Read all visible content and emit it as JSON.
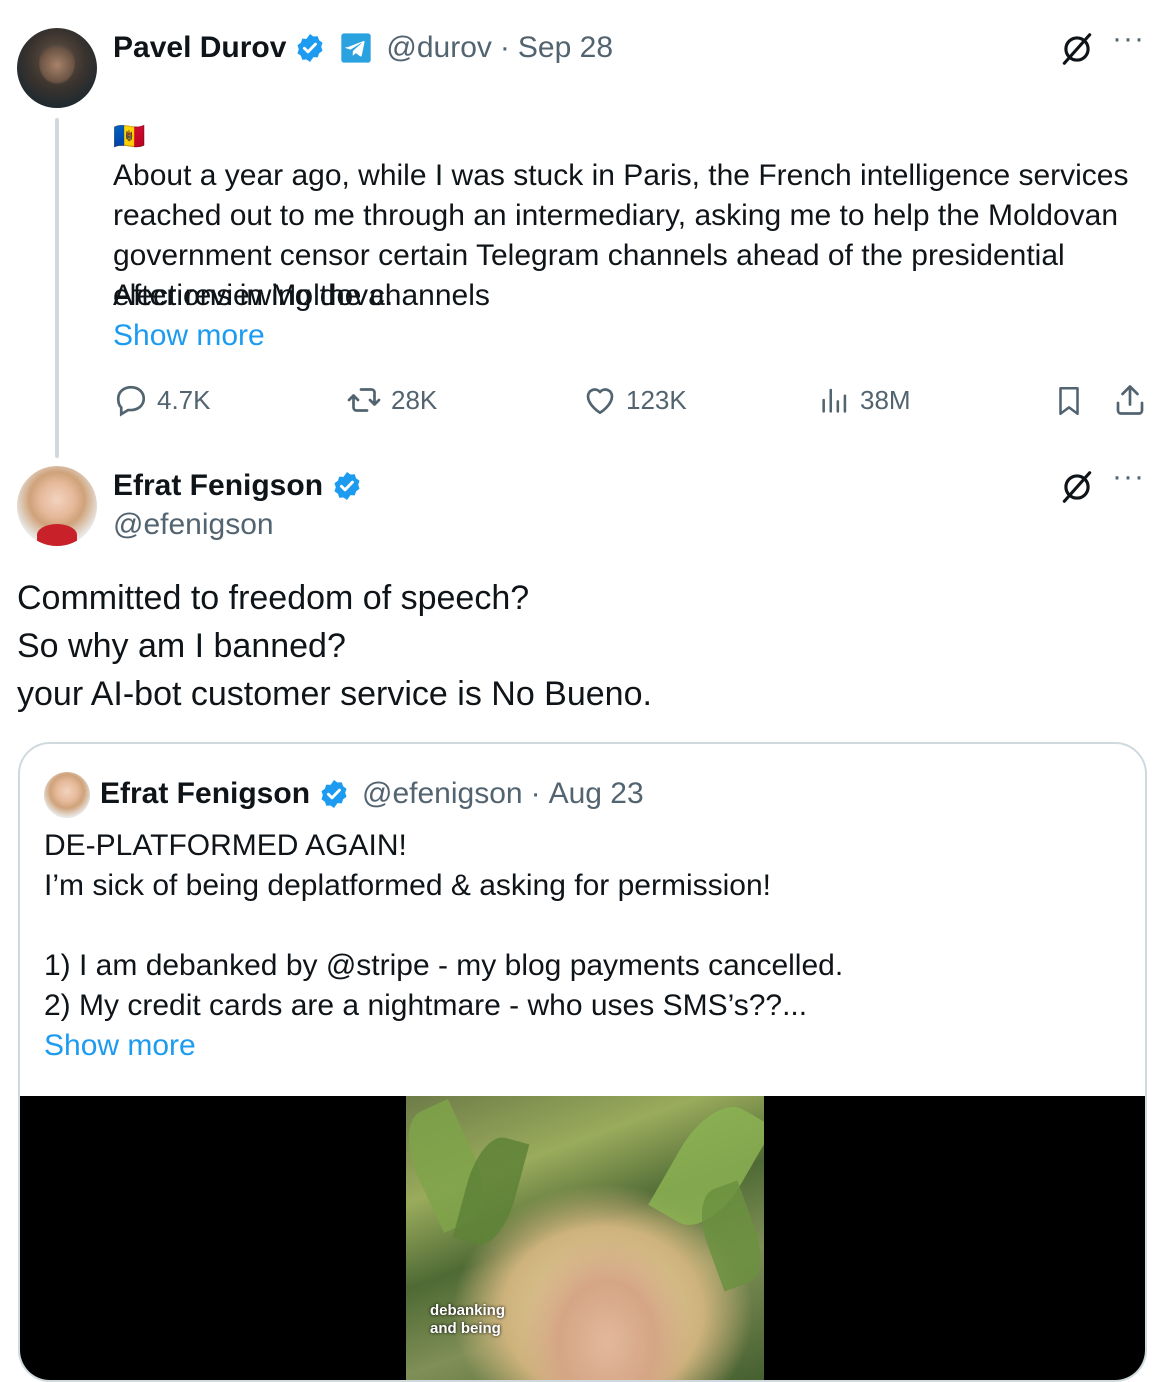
{
  "tweet1": {
    "name": "Pavel Durov",
    "handle": "@durov",
    "date": "Sep 28",
    "flag": "🇲🇩",
    "text": "About a year ago, while I was stuck in Paris, the French intelligence services reached out to me through an intermediary, asking me to help the Moldovan government censor certain Telegram channels ahead of the presidential elections in Moldova.",
    "text2": "After reviewing the channels",
    "show_more": "Show more",
    "stats": {
      "replies": "4.7K",
      "reposts": "28K",
      "likes": "123K",
      "views": "38M"
    }
  },
  "tweet2": {
    "name": "Efrat Fenigson",
    "handle": "@efenigson",
    "lines": [
      "Committed to freedom of speech?",
      "So why am I banned?",
      "your AI-bot customer service is No Bueno."
    ]
  },
  "quote": {
    "name": "Efrat Fenigson",
    "handle": "@efenigson",
    "date": "Aug 23",
    "line1": "DE-PLATFORMED AGAIN!",
    "line2": "I’m sick of being deplatformed & asking for permission!",
    "line3": "1) I am debanked by @stripe - my blog payments cancelled.",
    "line4": "2) My credit cards are a nightmare - who uses SMS’s??...",
    "show_more": "Show more",
    "media_caption_1": "debanking",
    "media_caption_2": "and being"
  },
  "colors": {
    "accent": "#1d9bf0",
    "verified": "#1d9bf0",
    "muted": "#536471"
  },
  "icons": [
    "verified-badge-icon",
    "telegram-icon",
    "grok-icon",
    "more-icon",
    "reply-icon",
    "repost-icon",
    "like-icon",
    "views-icon",
    "bookmark-icon",
    "share-icon"
  ]
}
